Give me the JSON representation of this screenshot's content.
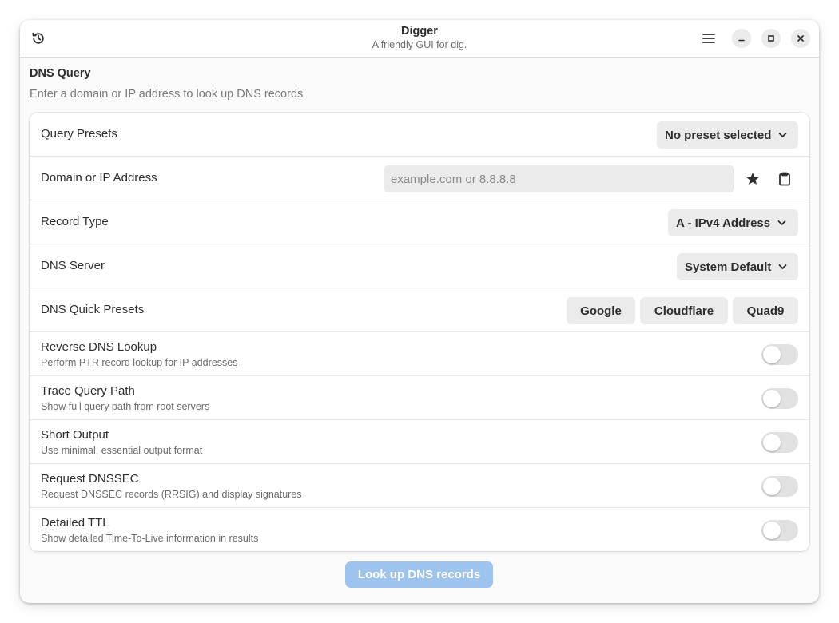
{
  "window": {
    "title": "Digger",
    "subtitle": "A friendly GUI for dig."
  },
  "headerbar": {
    "history_icon": "history-icon",
    "menu_icon": "hamburger-menu-icon",
    "minimize_icon": "minimize-icon",
    "maximize_icon": "maximize-icon",
    "close_icon": "close-icon"
  },
  "section": {
    "title": "DNS Query",
    "description": "Enter a domain or IP address to look up DNS records"
  },
  "rows": {
    "presets": {
      "label": "Query Presets",
      "selected": "No preset selected"
    },
    "domain": {
      "label": "Domain or IP Address",
      "value": "",
      "placeholder": "example.com or 8.8.8.8",
      "favorite_icon": "star-icon",
      "paste_icon": "clipboard-icon"
    },
    "record_type": {
      "label": "Record Type",
      "selected": "A - IPv4 Address"
    },
    "dns_server": {
      "label": "DNS Server",
      "selected": "System Default"
    },
    "quick_presets": {
      "label": "DNS Quick Presets",
      "buttons": [
        "Google",
        "Cloudflare",
        "Quad9"
      ]
    },
    "reverse": {
      "title": "Reverse DNS Lookup",
      "subtitle": "Perform PTR record lookup for IP addresses",
      "enabled": false
    },
    "trace": {
      "title": "Trace Query Path",
      "subtitle": "Show full query path from root servers",
      "enabled": false
    },
    "short": {
      "title": "Short Output",
      "subtitle": "Use minimal, essential output format",
      "enabled": false
    },
    "dnssec": {
      "title": "Request DNSSEC",
      "subtitle": "Request DNSSEC records (RRSIG) and display signatures",
      "enabled": false
    },
    "ttl": {
      "title": "Detailed TTL",
      "subtitle": "Show detailed Time-To-Live information in results",
      "enabled": false
    }
  },
  "action": {
    "lookup_label": "Look up DNS records",
    "enabled": false
  },
  "colors": {
    "accent_disabled": "#9dc4ef",
    "button_bg": "#ebebeb",
    "switch_off": "#e1e1e1"
  }
}
